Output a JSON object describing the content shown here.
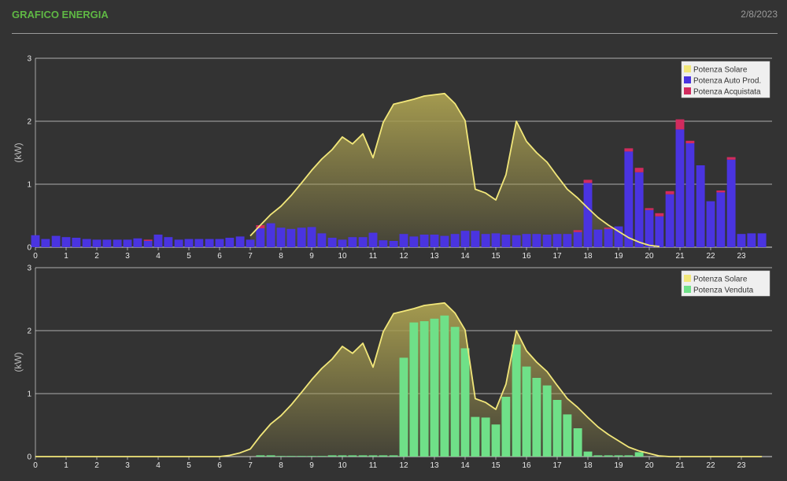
{
  "header": {
    "title": "GRAFICO ENERGIA",
    "date": "2/8/2023"
  },
  "colors": {
    "solar_line": "#f2e77a",
    "solar_fill": "#a49a4f",
    "auto_prod": "#4a34e0",
    "acquistata": "#d12b5e",
    "venduta": "#6fe088",
    "grid": "#d8d8d8",
    "tick_text": "#e8e8e8",
    "ylabel_text": "#bbbbbb"
  },
  "chart_data": [
    {
      "type": "bar",
      "ylabel": "(kW)",
      "ylim": [
        0,
        3
      ],
      "yticks": [
        "0",
        "1",
        "2",
        "3"
      ],
      "xlim": [
        0,
        24
      ],
      "xticks": [
        "0",
        "1",
        "2",
        "3",
        "4",
        "5",
        "6",
        "7",
        "8",
        "9",
        "10",
        "11",
        "12",
        "13",
        "14",
        "15",
        "16",
        "17",
        "18",
        "19",
        "20",
        "21",
        "22",
        "23"
      ],
      "bar_width": 0.28,
      "legend": {
        "position": "top-right",
        "entries": [
          {
            "name": "Potenza Solare",
            "color": "#f2e77a"
          },
          {
            "name": "Potenza Auto Prod.",
            "color": "#4a34e0"
          },
          {
            "name": "Potenza Acquistata",
            "color": "#d12b5e"
          }
        ]
      },
      "solar": {
        "name": "Potenza Solare",
        "x": [
          7.0,
          7.33,
          7.67,
          8.0,
          8.33,
          8.67,
          9.0,
          9.33,
          9.67,
          10.0,
          10.33,
          10.67,
          11.0,
          11.33,
          11.67,
          12.0,
          12.33,
          12.67,
          13.0,
          13.33,
          13.67,
          14.0,
          14.33,
          14.67,
          15.0,
          15.33,
          15.67,
          16.0,
          16.33,
          16.67,
          17.0,
          17.33,
          17.67,
          18.0,
          18.33,
          18.67,
          19.0,
          19.33,
          19.67,
          20.0,
          20.33
        ],
        "y": [
          0.18,
          0.35,
          0.52,
          0.65,
          0.82,
          1.02,
          1.22,
          1.4,
          1.55,
          1.75,
          1.64,
          1.8,
          1.42,
          1.98,
          2.27,
          2.31,
          2.35,
          2.4,
          2.42,
          2.44,
          2.28,
          2.01,
          0.92,
          0.86,
          0.75,
          1.15,
          2.0,
          1.68,
          1.5,
          1.35,
          1.13,
          0.92,
          0.78,
          0.62,
          0.47,
          0.35,
          0.25,
          0.15,
          0.08,
          0.03,
          0.01
        ]
      },
      "series": [
        {
          "name": "Potenza Auto Prod.",
          "x": [
            0.0,
            0.33,
            0.67,
            1.0,
            1.33,
            1.67,
            2.0,
            2.33,
            2.67,
            3.0,
            3.33,
            3.67,
            4.0,
            4.33,
            4.67,
            5.0,
            5.33,
            5.67,
            6.0,
            6.33,
            6.67,
            7.0,
            7.33,
            7.67,
            8.0,
            8.33,
            8.67,
            9.0,
            9.33,
            9.67,
            10.0,
            10.33,
            10.67,
            11.0,
            11.33,
            11.67,
            12.0,
            12.33,
            12.67,
            13.0,
            13.33,
            13.67,
            14.0,
            14.33,
            14.67,
            15.0,
            15.33,
            15.67,
            16.0,
            16.33,
            16.67,
            17.0,
            17.33,
            17.67,
            18.0,
            18.33,
            18.67,
            19.0,
            19.33,
            19.67,
            20.0,
            20.33,
            20.67,
            21.0,
            21.33,
            21.67,
            22.0,
            22.33,
            22.67,
            23.0,
            23.33,
            23.67
          ],
          "values": [
            0.19,
            0.13,
            0.18,
            0.16,
            0.15,
            0.13,
            0.12,
            0.12,
            0.12,
            0.12,
            0.14,
            0.1,
            0.2,
            0.16,
            0.12,
            0.13,
            0.13,
            0.13,
            0.13,
            0.15,
            0.17,
            0.12,
            0.3,
            0.38,
            0.31,
            0.29,
            0.31,
            0.32,
            0.22,
            0.15,
            0.12,
            0.16,
            0.16,
            0.23,
            0.11,
            0.1,
            0.21,
            0.17,
            0.2,
            0.2,
            0.18,
            0.21,
            0.26,
            0.26,
            0.21,
            0.22,
            0.2,
            0.19,
            0.21,
            0.21,
            0.2,
            0.21,
            0.21,
            0.24,
            1.02,
            0.28,
            0.29,
            0.33,
            1.52,
            1.19,
            0.59,
            0.49,
            0.84,
            1.87,
            1.65,
            1.3,
            0.73,
            0.87,
            1.39,
            0.21,
            0.22,
            0.22
          ]
        },
        {
          "name": "Potenza Acquistata",
          "x": [
            0.0,
            0.33,
            0.67,
            1.0,
            1.33,
            1.67,
            2.0,
            2.33,
            2.67,
            3.0,
            3.33,
            3.67,
            4.0,
            4.33,
            4.67,
            5.0,
            5.33,
            5.67,
            6.0,
            6.33,
            6.67,
            7.0,
            7.33,
            7.67,
            8.0,
            8.33,
            8.67,
            9.0,
            9.33,
            9.67,
            10.0,
            10.33,
            10.67,
            11.0,
            11.33,
            11.67,
            12.0,
            12.33,
            12.67,
            13.0,
            13.33,
            13.67,
            14.0,
            14.33,
            14.67,
            15.0,
            15.33,
            15.67,
            16.0,
            16.33,
            16.67,
            17.0,
            17.33,
            17.67,
            18.0,
            18.33,
            18.67,
            19.0,
            19.33,
            19.67,
            20.0,
            20.33,
            20.67,
            21.0,
            21.33,
            21.67,
            22.0,
            22.33,
            22.67,
            23.0,
            23.33,
            23.67
          ],
          "values": [
            0,
            0,
            0,
            0,
            0,
            0,
            0,
            0,
            0,
            0,
            0,
            0.02,
            0,
            0,
            0,
            0,
            0,
            0,
            0,
            0,
            0,
            0,
            0.05,
            0,
            0,
            0,
            0,
            0,
            0,
            0,
            0,
            0,
            0,
            0,
            0,
            0,
            0,
            0,
            0,
            0,
            0,
            0,
            0,
            0,
            0,
            0,
            0,
            0,
            0,
            0,
            0,
            0,
            0,
            0.03,
            0.05,
            0,
            0.02,
            0,
            0.05,
            0.07,
            0.03,
            0.05,
            0.05,
            0.16,
            0.04,
            0,
            0,
            0.03,
            0.04,
            0,
            0,
            0
          ]
        }
      ]
    },
    {
      "type": "bar",
      "ylabel": "(kW)",
      "ylim": [
        0,
        3
      ],
      "yticks": [
        "0",
        "1",
        "2",
        "3"
      ],
      "xlim": [
        0,
        24
      ],
      "xticks": [
        "0",
        "1",
        "2",
        "3",
        "4",
        "5",
        "6",
        "7",
        "8",
        "9",
        "10",
        "11",
        "12",
        "13",
        "14",
        "15",
        "16",
        "17",
        "18",
        "19",
        "20",
        "21",
        "22",
        "23"
      ],
      "bar_width": 0.28,
      "legend": {
        "position": "top-right",
        "entries": [
          {
            "name": "Potenza Solare",
            "color": "#f2e77a"
          },
          {
            "name": "Potenza Venduta",
            "color": "#6fe088"
          }
        ]
      },
      "solar": {
        "name": "Potenza Solare",
        "x": [
          0.0,
          0.33,
          0.67,
          1.0,
          1.33,
          1.67,
          2.0,
          2.33,
          2.67,
          3.0,
          3.33,
          3.67,
          4.0,
          4.33,
          4.67,
          5.0,
          5.33,
          5.67,
          6.0,
          6.33,
          6.67,
          7.0,
          7.33,
          7.67,
          8.0,
          8.33,
          8.67,
          9.0,
          9.33,
          9.67,
          10.0,
          10.33,
          10.67,
          11.0,
          11.33,
          11.67,
          12.0,
          12.33,
          12.67,
          13.0,
          13.33,
          13.67,
          14.0,
          14.33,
          14.67,
          15.0,
          15.33,
          15.67,
          16.0,
          16.33,
          16.67,
          17.0,
          17.33,
          17.67,
          18.0,
          18.33,
          18.67,
          19.0,
          19.33,
          19.67,
          20.0,
          20.33,
          20.67,
          21.0,
          21.33,
          21.67,
          22.0,
          22.33,
          22.67,
          23.0,
          23.33,
          23.67
        ],
        "y": [
          0,
          0,
          0,
          0,
          0,
          0,
          0,
          0,
          0,
          0,
          0,
          0,
          0,
          0,
          0,
          0,
          0,
          0,
          0,
          0.02,
          0.06,
          0.12,
          0.33,
          0.52,
          0.65,
          0.82,
          1.02,
          1.22,
          1.4,
          1.55,
          1.75,
          1.64,
          1.8,
          1.42,
          1.98,
          2.27,
          2.31,
          2.35,
          2.4,
          2.42,
          2.44,
          2.28,
          2.01,
          0.92,
          0.86,
          0.75,
          1.15,
          2.0,
          1.68,
          1.5,
          1.35,
          1.13,
          0.92,
          0.78,
          0.62,
          0.47,
          0.35,
          0.25,
          0.15,
          0.09,
          0.05,
          0.01,
          0,
          0,
          0,
          0,
          0,
          0,
          0,
          0,
          0,
          0
        ]
      },
      "series": [
        {
          "name": "Potenza Venduta",
          "x": [
            7.33,
            7.67,
            8.0,
            8.33,
            8.67,
            9.0,
            9.33,
            9.67,
            10.0,
            10.33,
            10.67,
            11.0,
            11.33,
            11.67,
            12.0,
            12.33,
            12.67,
            13.0,
            13.33,
            13.67,
            14.0,
            14.33,
            14.67,
            15.0,
            15.33,
            15.67,
            16.0,
            16.33,
            16.67,
            17.0,
            17.33,
            17.67,
            18.0,
            18.33,
            18.67,
            19.0,
            19.33,
            19.67
          ],
          "values": [
            0.02,
            0.02,
            0.01,
            0.01,
            0.01,
            0.01,
            0.01,
            0.02,
            0.02,
            0.02,
            0.02,
            0.02,
            0.02,
            0.02,
            1.57,
            2.13,
            2.15,
            2.19,
            2.24,
            2.06,
            1.72,
            0.63,
            0.62,
            0.51,
            0.95,
            1.78,
            1.43,
            1.25,
            1.13,
            0.9,
            0.67,
            0.45,
            0.08,
            0.02,
            0.02,
            0.02,
            0.02,
            0.07
          ]
        }
      ]
    }
  ]
}
